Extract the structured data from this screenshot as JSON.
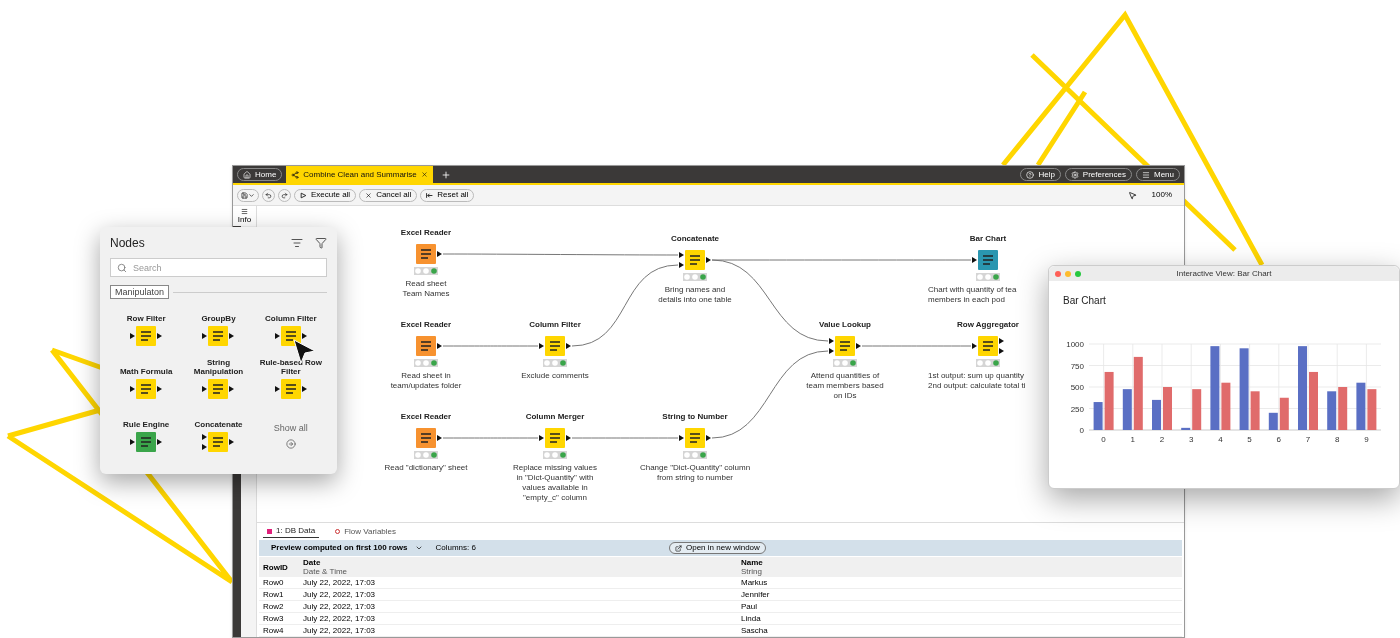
{
  "app": {
    "tabs": [
      {
        "label": "Home",
        "selected": false
      },
      {
        "label": "Combine Clean and Summarise",
        "selected": true
      }
    ],
    "header_buttons": [
      "Help",
      "Preferences",
      "Menu"
    ],
    "toolbar": {
      "buttons": [
        "Execute all",
        "Cancel all",
        "Reset all"
      ],
      "zoom": "100%"
    },
    "sidebar": {
      "label": "Info"
    }
  },
  "workflow": {
    "nodes": [
      {
        "title": "Excel Reader",
        "kind": "source",
        "executed": true,
        "description": "Read sheet\nTeam Names"
      },
      {
        "title": "Concatenate",
        "kind": "manipulator",
        "executed": true,
        "description": "Bring names and\ndetails into one table"
      },
      {
        "title": "Bar Chart",
        "kind": "visualizer",
        "executed": true,
        "description": "Chart with quantity of tea\nmembers in each pod"
      },
      {
        "title": "Excel Reader",
        "kind": "source",
        "executed": true,
        "description": "Read sheet in\nteam/updates folder"
      },
      {
        "title": "Column Filter",
        "kind": "manipulator",
        "executed": true,
        "description": "Exclude comments"
      },
      {
        "title": "Value Lookup",
        "kind": "manipulator",
        "executed": true,
        "description": "Attend quantities of\nteam members based\non IDs"
      },
      {
        "title": "Row Aggregator",
        "kind": "manipulator",
        "executed": true,
        "description": "1st output: sum up quantity\n2nd output: calculate total ti"
      },
      {
        "title": "Excel Reader",
        "kind": "source",
        "executed": true,
        "description": "Read \"dictionary\" sheet"
      },
      {
        "title": "Column Merger",
        "kind": "manipulator",
        "executed": true,
        "description": "Replace missing values\nin \"Dict-Quantity\" with\nvalues available in\n\"empty_c\" column"
      },
      {
        "title": "String to Number",
        "kind": "manipulator",
        "executed": true,
        "description": "Change \"Dict-Quantity\" column\nfrom string to number"
      }
    ]
  },
  "node_panel": {
    "title": "Nodes",
    "search": {
      "placeholder": "Search"
    },
    "category": "Manipulaton",
    "nodes": [
      {
        "title": "Row Filter",
        "kind": "manipulator"
      },
      {
        "title": "GroupBy",
        "kind": "manipulator"
      },
      {
        "title": "Column Filter",
        "kind": "manipulator"
      },
      {
        "title": "Math Formula",
        "kind": "manipulator"
      },
      {
        "title": "String Manipulation",
        "kind": "manipulator"
      },
      {
        "title": "Rule-based Row Filter",
        "kind": "manipulator"
      },
      {
        "title": "Rule Engine",
        "kind": "other"
      },
      {
        "title": "Concatenate",
        "kind": "manipulator"
      }
    ],
    "show_all": "Show all"
  },
  "bottom_panel": {
    "tabs": [
      {
        "label": "1: DB Data",
        "selected": true
      },
      {
        "label": "Flow Variables",
        "selected": false
      }
    ],
    "preview": "Preview computed on first 100 rows",
    "columns_count": "Columns: 6",
    "open_button": "Open in new window",
    "table": {
      "columns": [
        {
          "name": "RowID"
        },
        {
          "name": "Date",
          "type": "Date & Time"
        },
        {
          "name": "Name",
          "type": "String"
        }
      ],
      "rows": [
        [
          "Row0",
          "July 22, 2022, 17:03",
          "Markus"
        ],
        [
          "Row1",
          "July 22, 2022, 17:03",
          "Jennifer"
        ],
        [
          "Row2",
          "July 22, 2022, 17:03",
          "Paul"
        ],
        [
          "Row3",
          "July 22, 2022, 17:03",
          "Linda"
        ],
        [
          "Row4",
          "July 22, 2022, 17:03",
          "Sascha"
        ]
      ]
    }
  },
  "chart_window": {
    "title": "Interactive View: Bar Chart",
    "heading": "Bar Chart",
    "chart_data": {
      "type": "bar",
      "categories": [
        "0",
        "1",
        "2",
        "3",
        "4",
        "5",
        "6",
        "7",
        "8",
        "9"
      ],
      "series": [
        {
          "color": "#5a6fc4",
          "values": [
            325,
            475,
            350,
            25,
            975,
            950,
            200,
            975,
            450,
            550
          ]
        },
        {
          "color": "#e06b6b",
          "values": [
            675,
            850,
            500,
            475,
            550,
            450,
            375,
            675,
            500,
            475
          ]
        }
      ],
      "ylim": [
        0,
        1000
      ],
      "yticks": [
        0,
        250,
        500,
        750,
        1000
      ],
      "grid": true
    }
  }
}
